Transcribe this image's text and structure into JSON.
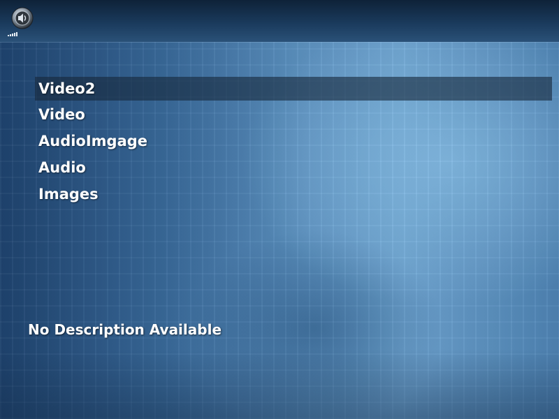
{
  "header": {
    "icon": "speaker-icon",
    "volume_icon": "volume-level-icon"
  },
  "menu": {
    "selected_index": 0,
    "items": [
      {
        "label": "Video2"
      },
      {
        "label": "Video"
      },
      {
        "label": "AudioImgage"
      },
      {
        "label": "Audio"
      },
      {
        "label": "Images"
      }
    ]
  },
  "description": {
    "text": "No Description Available"
  },
  "colors": {
    "text": "#ffffff",
    "highlight": "#1a2d42",
    "header_bar": "#1a3a5c",
    "background_accent": "#6fa6d3"
  }
}
